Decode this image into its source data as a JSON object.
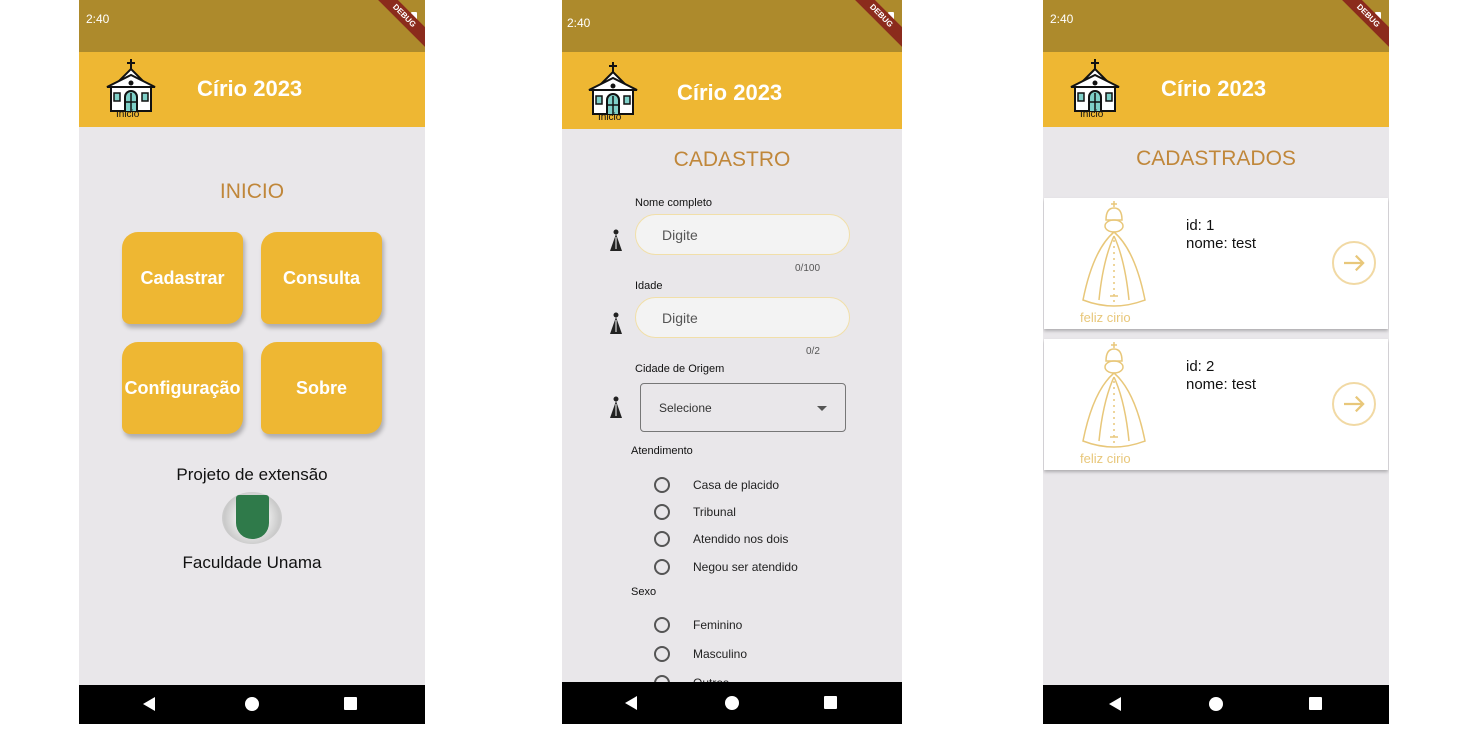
{
  "status": {
    "time": "2:40",
    "debug": "DEBUG"
  },
  "app_title": "Círio 2023",
  "home_label": "Inicio",
  "screen1": {
    "heading": "INICIO",
    "tiles": [
      "Cadastrar",
      "Consulta",
      "Configuração",
      "Sobre"
    ],
    "project": "Projeto de extensão",
    "faculty": "Faculdade Unama"
  },
  "screen2": {
    "heading": "CADASTRO",
    "name_label": "Nome completo",
    "name_placeholder": "Digite",
    "name_counter": "0/100",
    "age_label": "Idade",
    "age_placeholder": "Digite",
    "age_counter": "0/2",
    "city_label": "Cidade de Origem",
    "city_value": "Selecione",
    "attendance_label": "Atendimento",
    "attendance_options": [
      "Casa de placido",
      "Tribunal",
      "Atendido nos dois",
      "Negou ser atendido"
    ],
    "sex_label": "Sexo",
    "sex_options": [
      "Feminino",
      "Masculino",
      "Outros"
    ]
  },
  "screen3": {
    "heading": "CADASTRADOS",
    "records": [
      {
        "id": "id: 1",
        "name": "nome: test",
        "caption": "feliz cirio"
      },
      {
        "id": "id: 2",
        "name": "nome: test",
        "caption": "feliz cirio"
      }
    ]
  }
}
